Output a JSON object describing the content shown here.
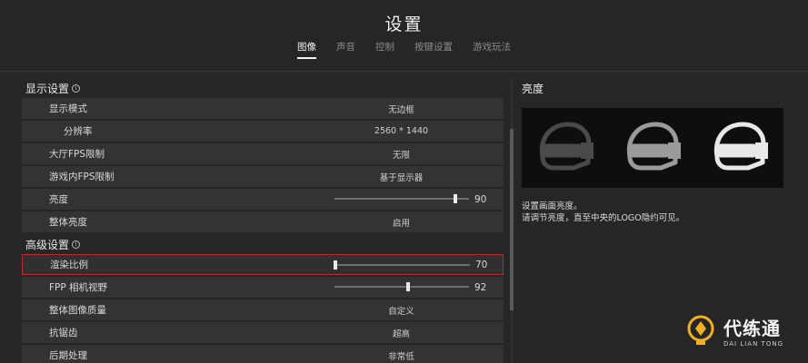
{
  "header": {
    "title": "设置"
  },
  "tabs": [
    {
      "label": "图像",
      "active": true
    },
    {
      "label": "声音",
      "active": false
    },
    {
      "label": "控制",
      "active": false
    },
    {
      "label": "按键设置",
      "active": false
    },
    {
      "label": "游戏玩法",
      "active": false
    }
  ],
  "display_section": {
    "title": "显示设置",
    "rows": [
      {
        "label": "显示模式",
        "value": "无边框"
      },
      {
        "label": "分辨率",
        "value": "2560 * 1440"
      },
      {
        "label": "大厅FPS限制",
        "value": "无限"
      },
      {
        "label": "游戏内FPS限制",
        "value": "基于显示器"
      },
      {
        "label": "亮度",
        "slider_value": "90",
        "slider_level": 0.9
      },
      {
        "label": "整体亮度",
        "value": "启用"
      }
    ]
  },
  "advanced_section": {
    "title": "高级设置",
    "rows": [
      {
        "label": "渲染比例",
        "slider_value": "70",
        "slider_level": 0.0
      },
      {
        "label": "FPP 相机视野",
        "slider_value": "92",
        "slider_level": 0.55
      },
      {
        "label": "整体图像质量",
        "value": "自定义"
      },
      {
        "label": "抗锯齿",
        "value": "超高"
      },
      {
        "label": "后期处理",
        "value": "非常低"
      }
    ]
  },
  "right_panel": {
    "heading": "亮度",
    "description_line1": "设置画面亮度。",
    "description_line2": "请调节亮度，直至中央的LOGO隐约可见。",
    "preview_icons": [
      "helmet-icon-dark",
      "helmet-icon-medium",
      "helmet-icon-light"
    ],
    "colors": {
      "dark": "#4a4a4a",
      "medium": "#9a9a9a",
      "light": "#e8e8e8"
    }
  },
  "watermark": {
    "cn": "代练通",
    "en": "DAI LIAN TONG"
  }
}
